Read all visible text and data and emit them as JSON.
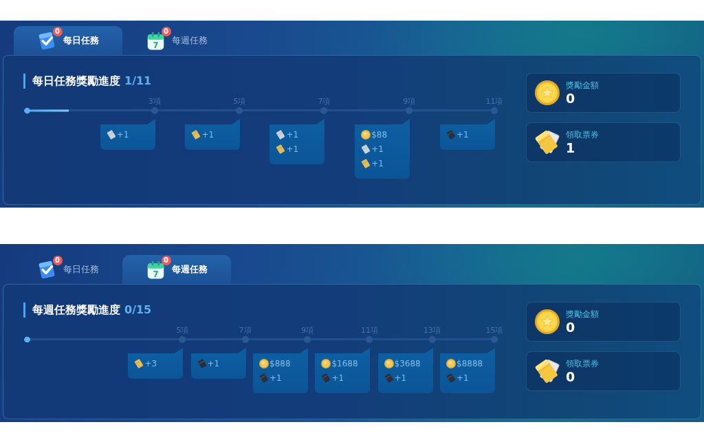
{
  "panels": [
    {
      "tabs": [
        {
          "label": "每日任務",
          "badge": "0",
          "selected": true
        },
        {
          "label": "每週任務",
          "badge": "0",
          "icon_text": "7",
          "selected": false
        }
      ],
      "progress": {
        "title": "每日任務獎勵進度",
        "count": "1/11",
        "level": 0.09,
        "milestones": [
          {
            "label": "3項",
            "level": 0.273,
            "rewards": [
              {
                "kind": "silver",
                "amount": "+1"
              }
            ]
          },
          {
            "label": "5項",
            "level": 0.455,
            "rewards": [
              {
                "kind": "gold",
                "amount": "+1"
              }
            ]
          },
          {
            "label": "7項",
            "level": 0.636,
            "rewards": [
              {
                "kind": "silver",
                "amount": "+1"
              },
              {
                "kind": "gold",
                "amount": "+1"
              }
            ]
          },
          {
            "label": "9項",
            "level": 0.818,
            "rewards": [
              {
                "kind": "coin",
                "amount": "$88"
              },
              {
                "kind": "silver",
                "amount": "+1"
              },
              {
                "kind": "gold",
                "amount": "+1"
              }
            ]
          },
          {
            "label": "11項",
            "level": 1,
            "rewards": [
              {
                "kind": "black",
                "amount": "+1"
              }
            ]
          }
        ]
      },
      "summary": [
        {
          "label": "獎勵金額",
          "value": "0"
        },
        {
          "label": "領取票券",
          "value": "1"
        }
      ]
    },
    {
      "tabs": [
        {
          "label": "每日任務",
          "badge": "0",
          "selected": false
        },
        {
          "label": "每週任務",
          "badge": "0",
          "icon_text": "7",
          "selected": true
        }
      ],
      "progress": {
        "title": "每週任務獎勵進度",
        "count": "0/15",
        "level": 0,
        "milestones": [
          {
            "label": "5項",
            "level": 0.333,
            "rewards": [
              {
                "kind": "gold",
                "amount": "+3"
              }
            ]
          },
          {
            "label": "7項",
            "level": 0.467,
            "rewards": [
              {
                "kind": "black",
                "amount": "+1"
              }
            ]
          },
          {
            "label": "9項",
            "level": 0.6,
            "rewards": [
              {
                "kind": "coin",
                "amount": "$888"
              },
              {
                "kind": "black",
                "amount": "+1"
              }
            ]
          },
          {
            "label": "11項",
            "level": 0.733,
            "rewards": [
              {
                "kind": "coin",
                "amount": "$1688"
              },
              {
                "kind": "black",
                "amount": "+1"
              }
            ]
          },
          {
            "label": "13項",
            "level": 0.867,
            "rewards": [
              {
                "kind": "coin",
                "amount": "$3688"
              },
              {
                "kind": "black",
                "amount": "+1"
              }
            ]
          },
          {
            "label": "15項",
            "level": 1,
            "rewards": [
              {
                "kind": "coin",
                "amount": "$8888"
              },
              {
                "kind": "black",
                "amount": "+1"
              }
            ]
          }
        ]
      },
      "summary": [
        {
          "label": "獎勵金額",
          "value": "0"
        },
        {
          "label": "領取票券",
          "value": "0"
        }
      ]
    }
  ]
}
